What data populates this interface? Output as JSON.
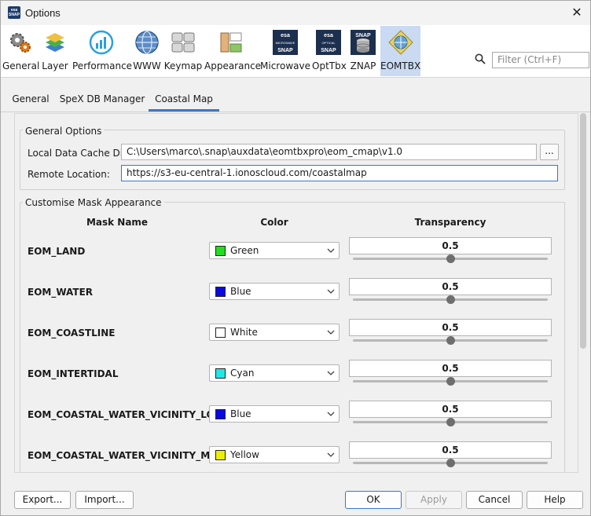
{
  "window": {
    "title": "Options",
    "app_icon_text": "esa SNAP"
  },
  "toolbar": {
    "items": [
      {
        "label": "General",
        "icon": "gears-icon"
      },
      {
        "label": "Layer",
        "icon": "layers-icon"
      },
      {
        "label": "Performance",
        "icon": "gauge-icon"
      },
      {
        "label": "WWW",
        "icon": "globe-icon"
      },
      {
        "label": "Keymap",
        "icon": "keyboard-icon"
      },
      {
        "label": "Appearance",
        "icon": "palette-icon"
      },
      {
        "label": "Microwave",
        "icon": "esa-microwave-icon",
        "badge_top": "esa",
        "badge_mid": "MICROWAVE",
        "badge_bottom": "SNAP"
      },
      {
        "label": "OptTbx",
        "icon": "esa-optical-icon",
        "badge_top": "esa",
        "badge_mid": "OPTICAL",
        "badge_bottom": "SNAP"
      },
      {
        "label": "ZNAP",
        "icon": "snap-database-icon",
        "badge_top": "SNAP"
      },
      {
        "label": "EOMTBX",
        "icon": "eomtbx-diamond-icon",
        "selected": true
      }
    ],
    "filter_placeholder": "Filter (Ctrl+F)"
  },
  "tabs": [
    {
      "label": "General"
    },
    {
      "label": "SpeX DB Manager"
    },
    {
      "label": "Coastal Map",
      "active": true
    }
  ],
  "general_options": {
    "title": "General Options",
    "cache_label": "Local Data Cache Dir:",
    "cache_value": "C:\\Users\\marco\\.snap\\auxdata\\eomtbxpro\\eom_cmap\\v1.0",
    "browse_label": "...",
    "remote_label": "Remote Location:",
    "remote_value": "https://s3-eu-central-1.ionoscloud.com/coastalmap"
  },
  "mask_appearance": {
    "title": "Customise Mask Appearance",
    "col_name": "Mask Name",
    "col_color": "Color",
    "col_transparency": "Transparency",
    "rows": [
      {
        "name": "EOM_LAND",
        "color_label": "Green",
        "swatch": "#22dd22",
        "transparency": "0.5"
      },
      {
        "name": "EOM_WATER",
        "color_label": "Blue",
        "swatch": "#0a0ae0",
        "transparency": "0.5"
      },
      {
        "name": "EOM_COASTLINE",
        "color_label": "White",
        "swatch": "#ffffff",
        "transparency": "0.5"
      },
      {
        "name": "EOM_INTERTIDAL",
        "color_label": "Cyan",
        "swatch": "#22e6e6",
        "transparency": "0.5"
      },
      {
        "name": "EOM_COASTAL_WATER_VICINITY_LOW",
        "color_label": "Blue",
        "swatch": "#0a0ae0",
        "transparency": "0.5"
      },
      {
        "name": "EOM_COASTAL_WATER_VICINITY_MID",
        "color_label": "Yellow",
        "swatch": "#eeee00",
        "transparency": "0.5"
      }
    ]
  },
  "buttons": {
    "export": "Export...",
    "import": "Import...",
    "ok": "OK",
    "apply": "Apply",
    "cancel": "Cancel",
    "help": "Help"
  }
}
